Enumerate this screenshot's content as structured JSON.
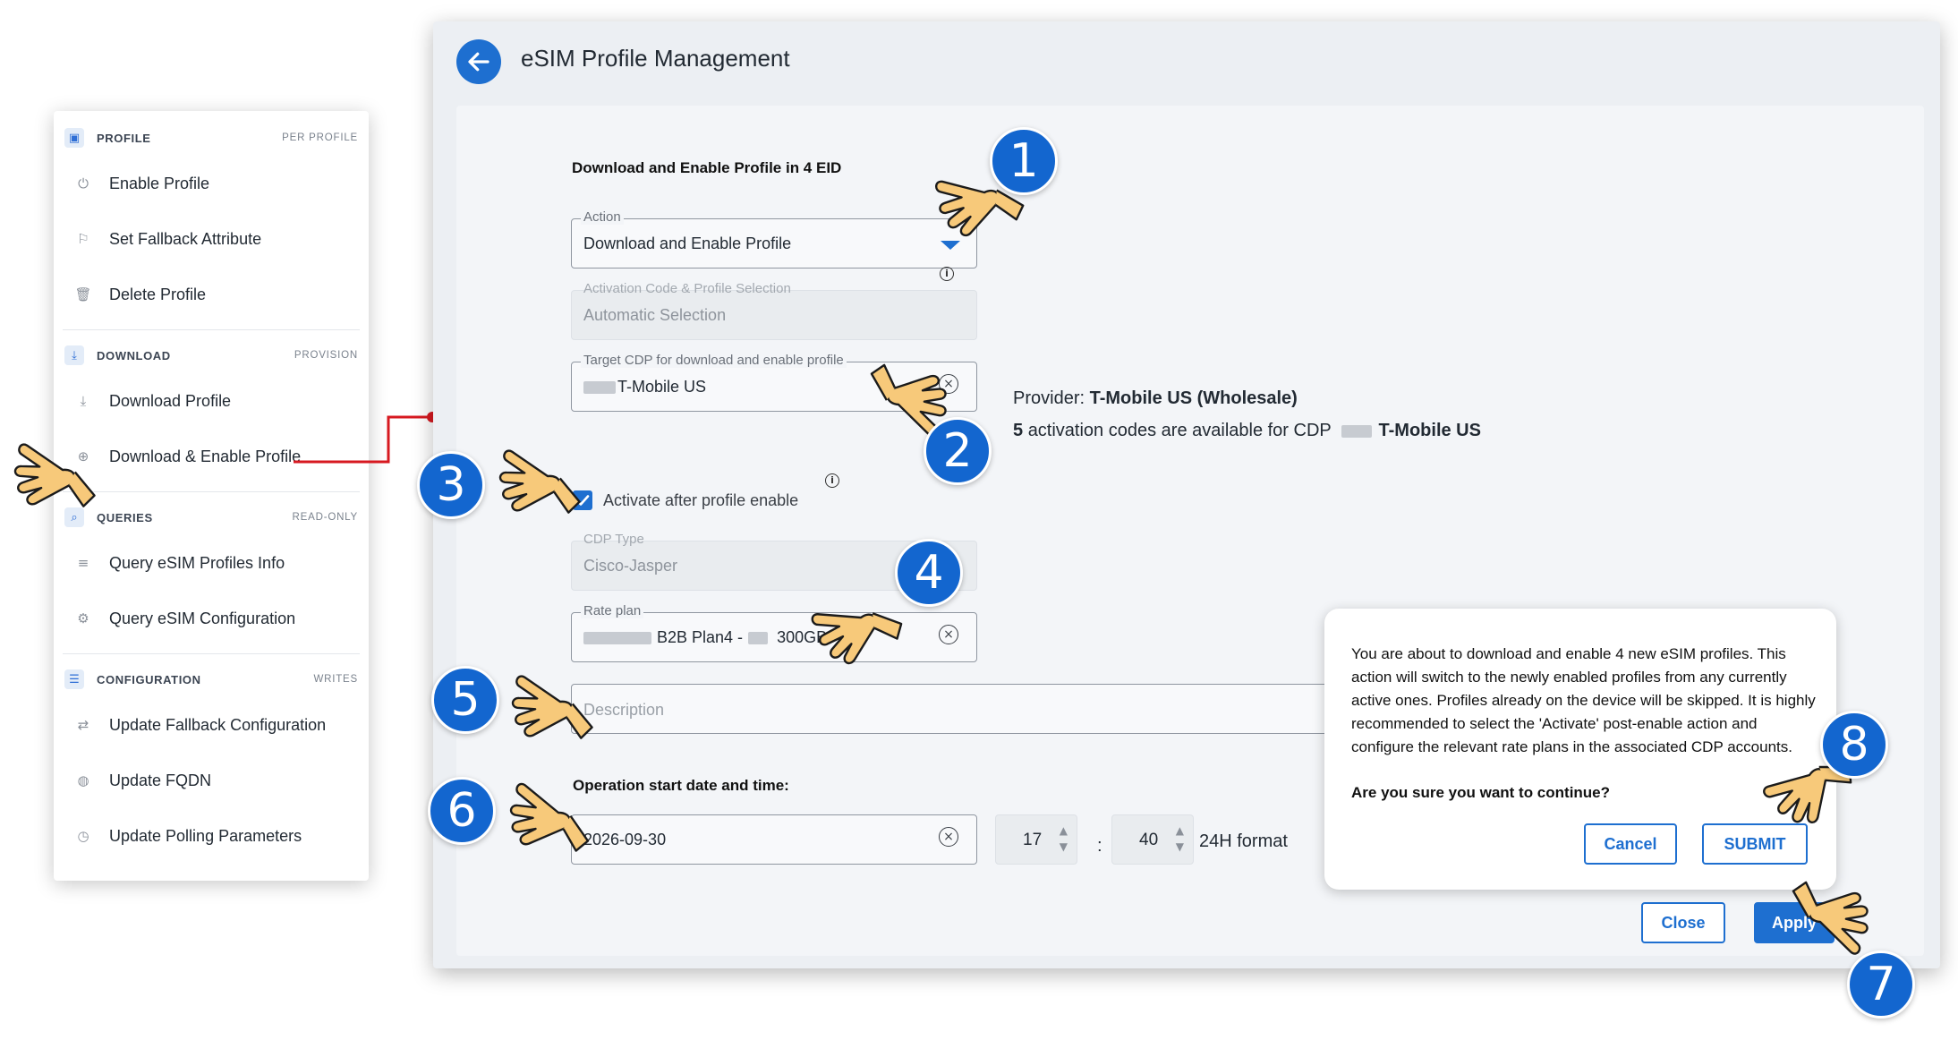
{
  "menu": {
    "sections": [
      {
        "title": "PROFILE",
        "tag": "PER PROFILE",
        "icon": "sim-card-icon",
        "items": [
          {
            "label": "Enable Profile",
            "icon": "power-icon"
          },
          {
            "label": "Set Fallback Attribute",
            "icon": "flag-icon"
          },
          {
            "label": "Delete Profile",
            "icon": "trash-icon"
          }
        ]
      },
      {
        "title": "DOWNLOAD",
        "tag": "PROVISION",
        "icon": "download-icon",
        "items": [
          {
            "label": "Download Profile",
            "icon": "download-icon"
          },
          {
            "label": "Download & Enable Profile",
            "icon": "download-circle-icon"
          }
        ]
      },
      {
        "title": "QUERIES",
        "tag": "READ-ONLY",
        "icon": "search-icon",
        "items": [
          {
            "label": "Query eSIM Profiles Info",
            "icon": "list-search-icon"
          },
          {
            "label": "Query eSIM Configuration",
            "icon": "settings-search-icon"
          }
        ]
      },
      {
        "title": "CONFIGURATION",
        "tag": "WRITES",
        "icon": "sliders-icon",
        "items": [
          {
            "label": "Update Fallback Configuration",
            "icon": "swap-icon"
          },
          {
            "label": "Update FQDN",
            "icon": "globe-icon"
          },
          {
            "label": "Update Polling Parameters",
            "icon": "clock-icon"
          }
        ]
      }
    ]
  },
  "dialog": {
    "title": "eSIM Profile Management",
    "section_title": "Download and Enable Profile in 4 EID",
    "action": {
      "label": "Action",
      "value": "Download and Enable Profile"
    },
    "activation": {
      "label": "Activation Code & Profile Selection",
      "value": "Automatic Selection"
    },
    "target_cdp": {
      "label": "Target CDP for download and enable profile",
      "value": "T-Mobile US"
    },
    "provider": {
      "prefix": "Provider:",
      "name": "T-Mobile US (Wholesale)"
    },
    "codes": {
      "count": "5",
      "text": "activation codes are available for CDP",
      "cdp": "T-Mobile US"
    },
    "activate_checkbox": {
      "label": "Activate after profile enable",
      "checked": true
    },
    "cdp_type": {
      "label": "CDP Type",
      "value": "Cisco-Jasper"
    },
    "rate_plan": {
      "label": "Rate plan",
      "part1": "B2B Plan4 -",
      "part2": "300GB"
    },
    "description": {
      "placeholder": "Description"
    },
    "operation": {
      "label": "Operation start date and time:",
      "date": "2026-09-30",
      "hour": "17",
      "separator": ":",
      "minute": "40",
      "format": "24H format"
    },
    "buttons": {
      "close": "Close",
      "apply": "Apply"
    }
  },
  "confirm": {
    "text": "You are about to download and enable 4 new eSIM profiles. This action will switch to the newly enabled profiles from any currently active ones. Profiles already on the device will be skipped. It is highly recommended to select the 'Activate' post-enable action and configure the relevant rate plans in the associated CDP accounts.",
    "question": "Are you sure you want to continue?",
    "cancel": "Cancel",
    "submit": "SUBMIT"
  },
  "markers": [
    "1",
    "2",
    "3",
    "4",
    "5",
    "6",
    "7",
    "8"
  ],
  "colors": {
    "accent": "#1e6fd0",
    "marker": "#1366cf",
    "connector": "#d71920",
    "hand": "#f7c97a"
  }
}
